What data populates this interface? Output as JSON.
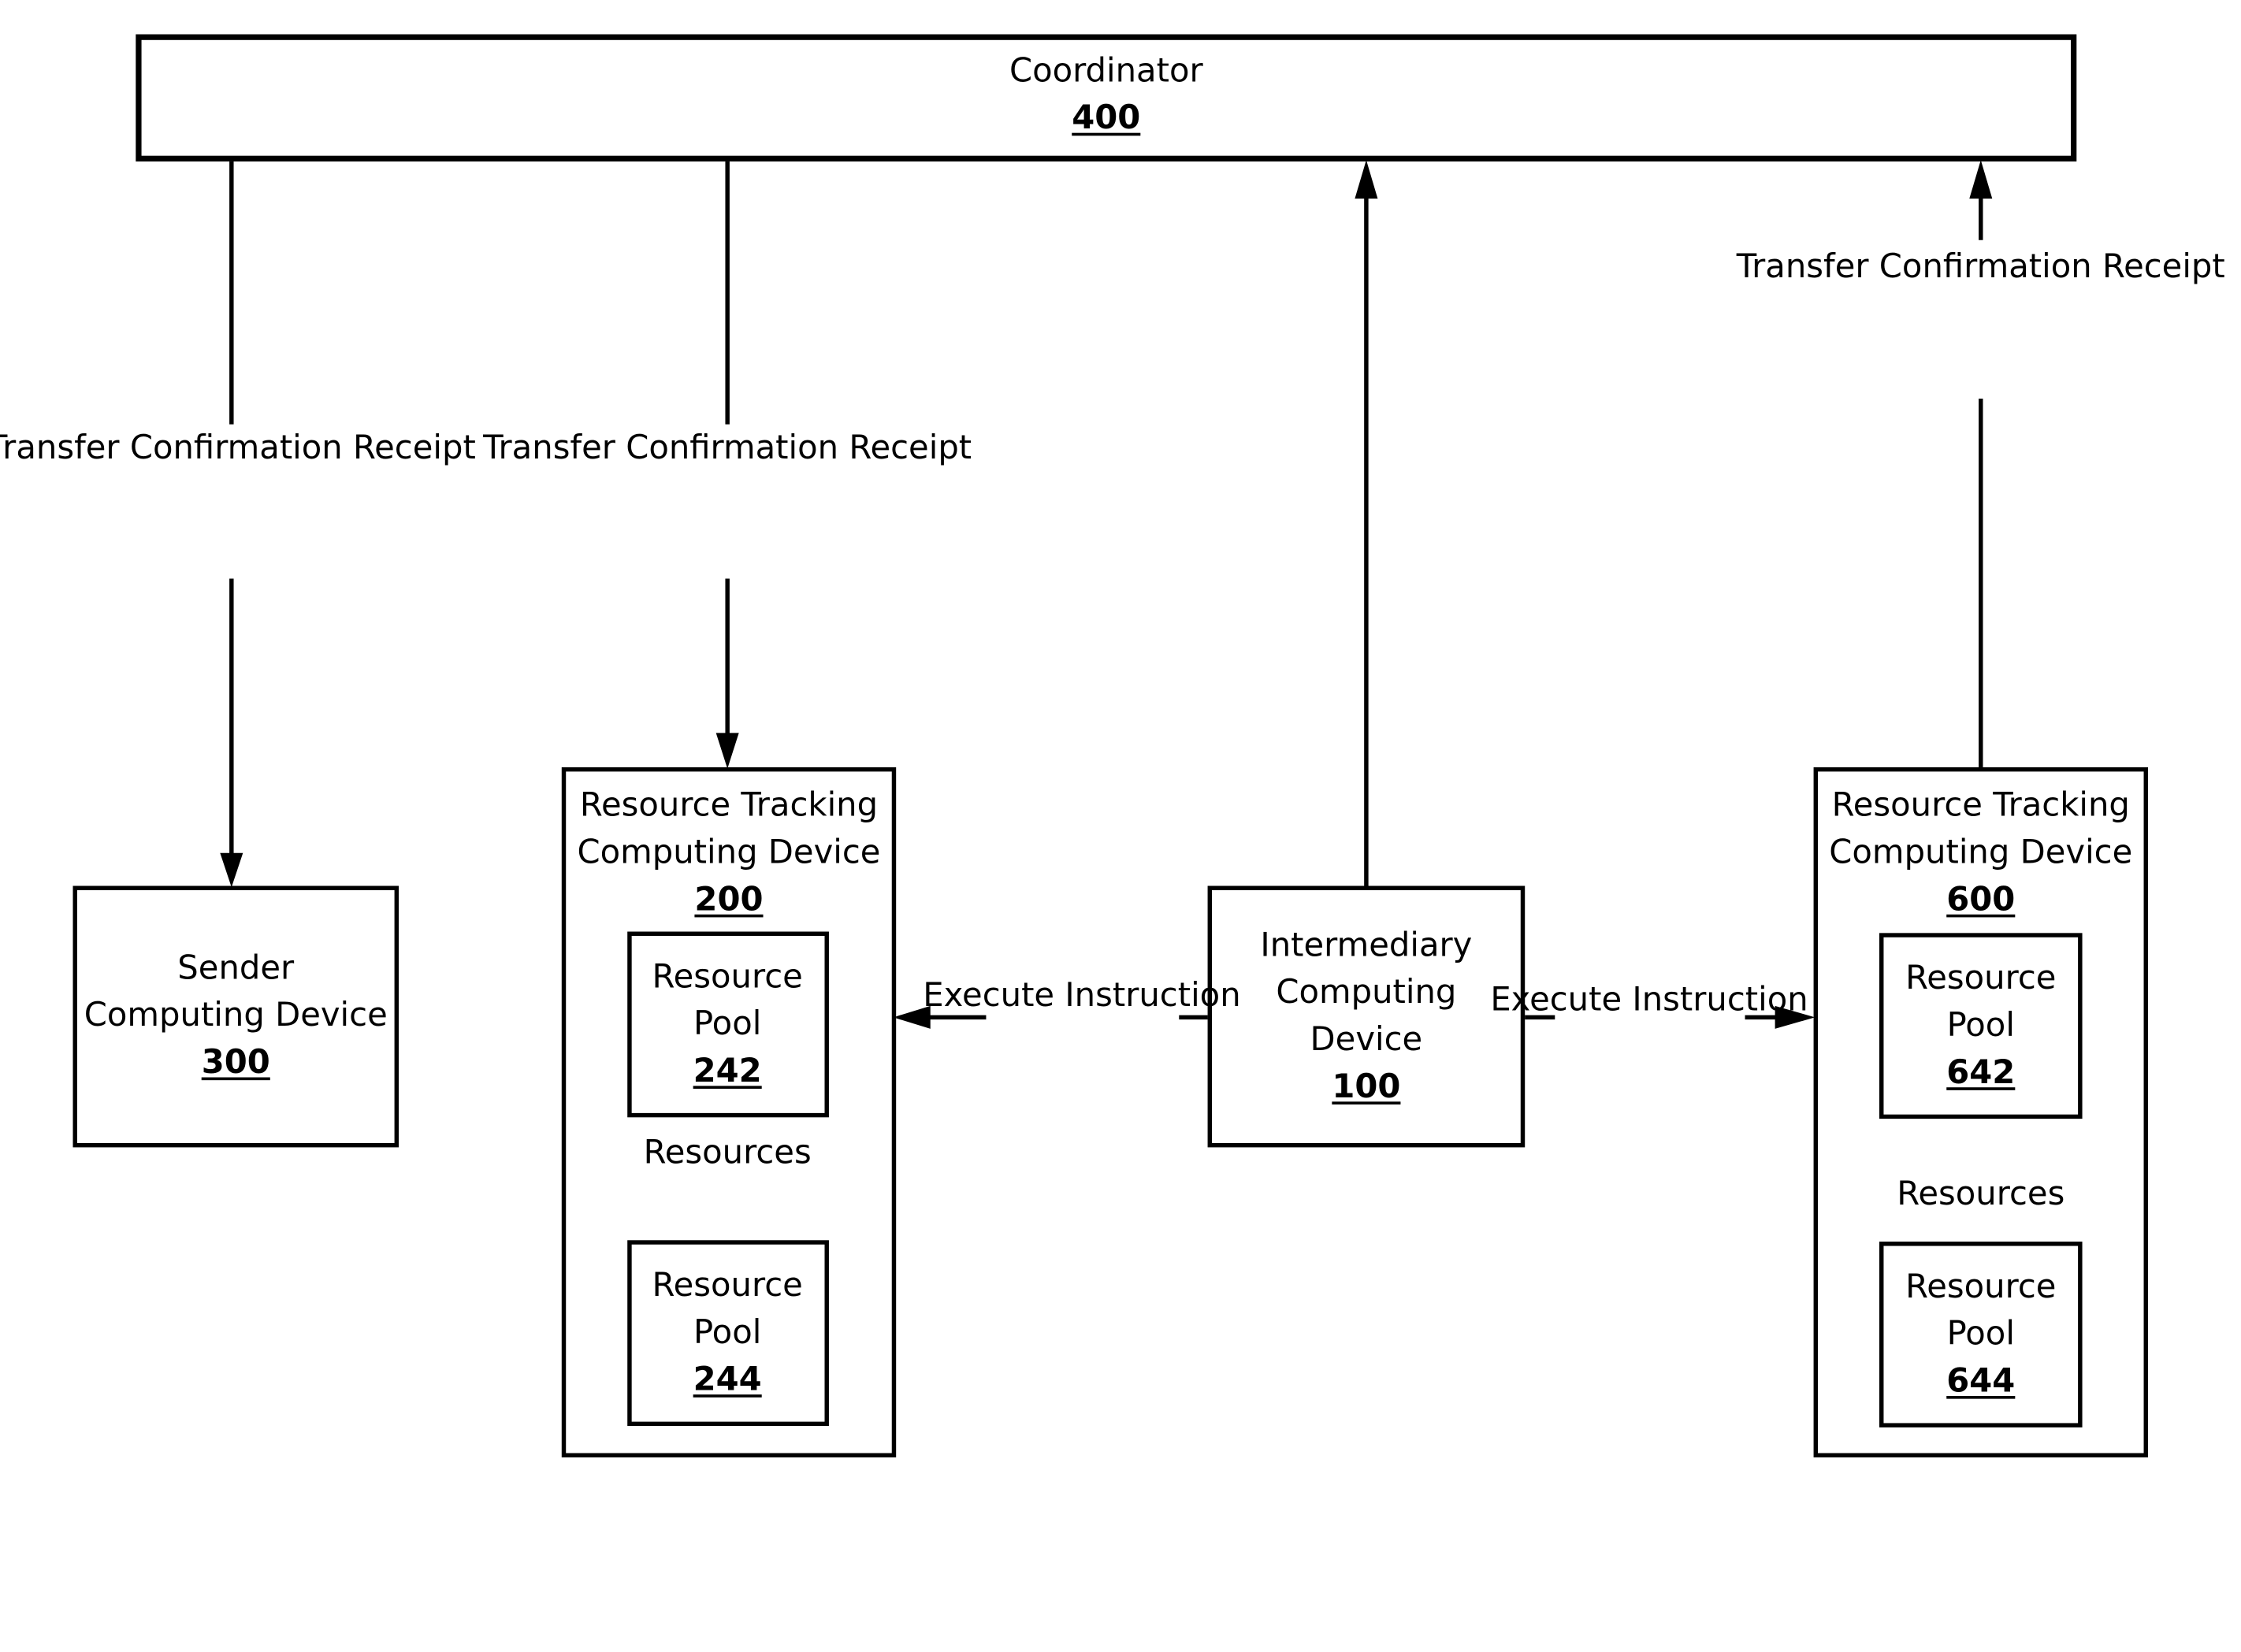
{
  "figure": {
    "nodes": {
      "coordinator": {
        "title": "Coordinator",
        "ref": "400"
      },
      "sender": {
        "title_lines": [
          "Sender",
          "Computing Device"
        ],
        "ref": "300"
      },
      "tracker_a": {
        "title_lines": [
          "Resource Tracking",
          "Computing Device"
        ],
        "ref": "200"
      },
      "pool_242": {
        "title_lines": [
          "Resource",
          "Pool"
        ],
        "ref": "242"
      },
      "pool_244": {
        "title_lines": [
          "Resource",
          "Pool"
        ],
        "ref": "244"
      },
      "intermediary": {
        "title_lines": [
          "Intermediary",
          "Computing",
          "Device"
        ],
        "ref": "100"
      },
      "tracker_b": {
        "title_lines": [
          "Resource Tracking",
          "Computing Device"
        ],
        "ref": "600"
      },
      "pool_642": {
        "title_lines": [
          "Resource",
          "Pool"
        ],
        "ref": "642"
      },
      "pool_644": {
        "title_lines": [
          "Resource",
          "Pool"
        ],
        "ref": "644"
      }
    },
    "edges": {
      "coord_to_sender": {
        "label_lines": [
          "Transfer",
          "Confirmation",
          "Receipt"
        ],
        "from": "400",
        "to": "300"
      },
      "coord_to_tracker_a": {
        "label_lines": [
          "Transfer",
          "Confirmation",
          "Receipt"
        ],
        "from": "400",
        "to": "200"
      },
      "intermediary_to_coord": {
        "label_lines": [],
        "from": "100",
        "to": "400"
      },
      "tracker_b_to_coord": {
        "label_lines": [
          "Transfer",
          "Confirmation",
          "Receipt"
        ],
        "from": "600",
        "to": "400"
      },
      "intermediary_to_tracker_a": {
        "label_lines": [
          "Execute",
          "Instruction"
        ],
        "from": "100",
        "to": "200"
      },
      "intermediary_to_tracker_b": {
        "label_lines": [
          "Execute",
          "Instruction"
        ],
        "from": "100",
        "to": "600"
      },
      "pool_242_to_244": {
        "label_lines": [
          "Resources"
        ],
        "from": "242",
        "to": "244"
      },
      "pool_644_to_642": {
        "label_lines": [
          "Resources"
        ],
        "from": "644",
        "to": "642"
      }
    }
  }
}
